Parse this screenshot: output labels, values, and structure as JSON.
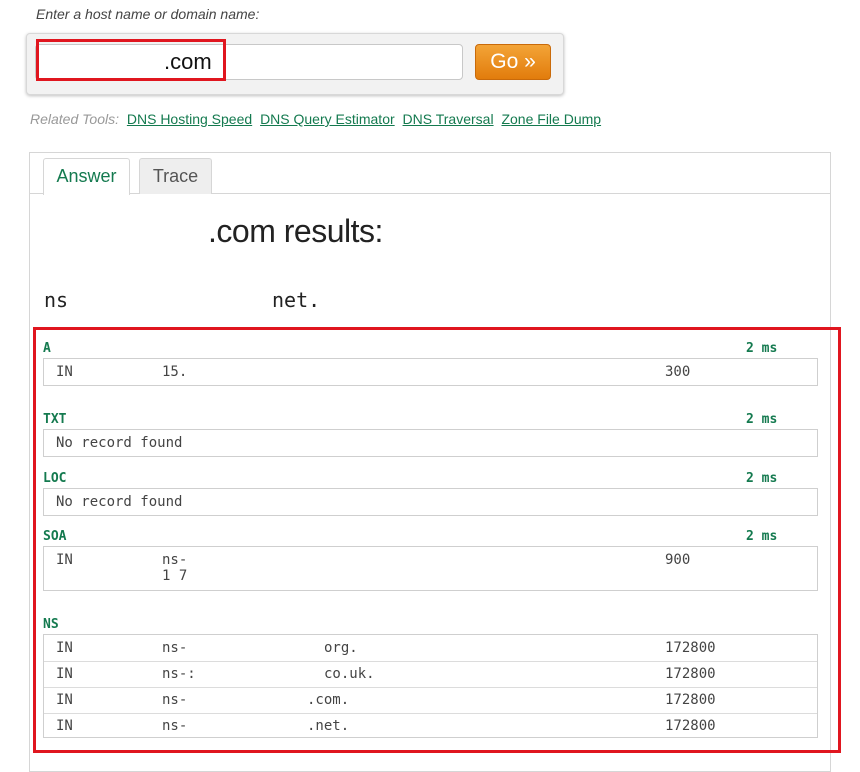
{
  "prompt": "Enter a host name or domain name:",
  "search": {
    "value": ".com",
    "button": "Go »"
  },
  "related": {
    "label": "Related Tools:",
    "links": [
      "DNS Hosting Speed",
      "DNS Query Estimator",
      "DNS Traversal",
      "Zone File Dump"
    ]
  },
  "tabs": [
    "Answer",
    "Trace"
  ],
  "results_title": ".com results:",
  "ns_header": {
    "left": "ns",
    "right": "net."
  },
  "records": {
    "a": {
      "type": "A",
      "time": "2 ms",
      "row": {
        "class": "IN",
        "value": "15.",
        "ttl": "300"
      }
    },
    "txt": {
      "type": "TXT",
      "time": "2 ms",
      "text": "No record found"
    },
    "loc": {
      "type": "LOC",
      "time": "2 ms",
      "text": "No record found"
    },
    "soa": {
      "type": "SOA",
      "time": "2 ms",
      "row": {
        "class": "IN",
        "value_line1": "ns-",
        "value_line2": "1 7",
        "ttl": "900"
      }
    },
    "ns": {
      "type": "NS",
      "rows": [
        {
          "class": "IN",
          "prefix": "ns-",
          "suffix": "org.",
          "ttl": "172800"
        },
        {
          "class": "IN",
          "prefix": "ns-:",
          "suffix": "co.uk.",
          "ttl": "172800"
        },
        {
          "class": "IN",
          "prefix": "ns-",
          "suffix": ".com.",
          "ttl": "172800"
        },
        {
          "class": "IN",
          "prefix": "ns-",
          "suffix": ".net.",
          "ttl": "172800"
        }
      ]
    }
  },
  "colors": {
    "accent": "#147a4f",
    "highlight": "#e0161f",
    "go_button": "#e8891a"
  }
}
